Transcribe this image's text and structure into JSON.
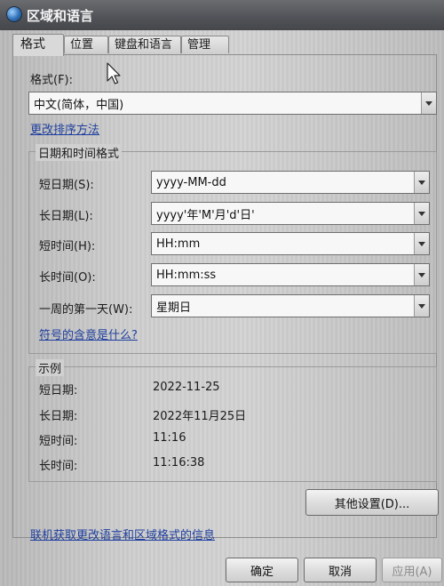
{
  "window": {
    "title": "区域和语言",
    "icon": "globe-icon"
  },
  "tabs": [
    {
      "label": "格式",
      "active": true
    },
    {
      "label": "位置",
      "active": false
    },
    {
      "label": "键盘和语言",
      "active": false
    },
    {
      "label": "管理",
      "active": false
    }
  ],
  "format": {
    "label": "格式(F):",
    "value": "中文(简体，中国)",
    "change_sort_link": "更改排序方法"
  },
  "datetime_group": {
    "title": "日期和时间格式",
    "rows": [
      {
        "label": "短日期(S):",
        "value": "yyyy-MM-dd"
      },
      {
        "label": "长日期(L):",
        "value": "yyyy'年'M'月'd'日'"
      },
      {
        "label": "短时间(H):",
        "value": "HH:mm"
      },
      {
        "label": "长时间(O):",
        "value": "HH:mm:ss"
      },
      {
        "label": "一周的第一天(W):",
        "value": "星期日"
      }
    ],
    "symbols_link": "符号的含意是什么?"
  },
  "examples_group": {
    "title": "示例",
    "rows": [
      {
        "label": "短日期:",
        "value": "2022-11-25"
      },
      {
        "label": "长日期:",
        "value": "2022年11月25日"
      },
      {
        "label": "短时间:",
        "value": "11:16"
      },
      {
        "label": "长时间:",
        "value": "11:16:38"
      }
    ]
  },
  "other_settings_button": "其他设置(D)...",
  "online_link": "联机获取更改语言和区域格式的信息",
  "footer": {
    "ok": "确定",
    "cancel": "取消",
    "apply": "应用(A)"
  },
  "colors": {
    "link": "#1f3f9e",
    "titlebar": "#505257"
  }
}
